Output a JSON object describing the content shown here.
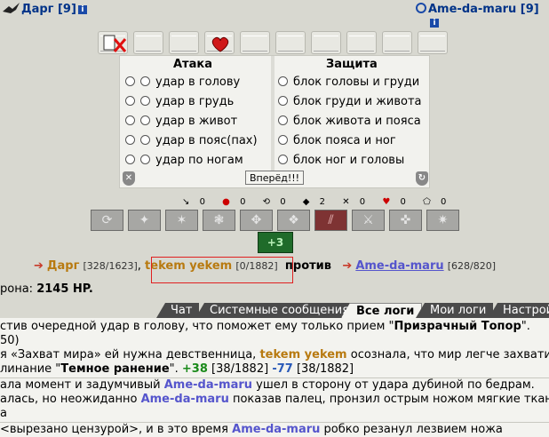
{
  "header": {
    "left_name": "Дарг [9]",
    "right_name": "Ame-da-maru [9]",
    "info_icon": "i"
  },
  "panel": {
    "attack_title": "Атака",
    "defense_title": "Защита",
    "attack_options": [
      "удар в голову",
      "удар в грудь",
      "удар в живот",
      "удар в пояс(пах)",
      "удар по ногам"
    ],
    "defense_options": [
      "блок головы и груди",
      "блок груди и живота",
      "блок живота и пояса",
      "блок пояса и ног",
      "блок ног и головы"
    ],
    "forward_label": "Вперёд!!!"
  },
  "counters": [
    "0",
    "0",
    "0",
    "2",
    "0",
    "0",
    "0"
  ],
  "special_label": "+3",
  "versus": {
    "p1_name": "Дарг",
    "p1_hp": "[328/1623]",
    "p2_name": "tekem yekem",
    "p2_hp": "[0/1882]",
    "vs_word": "против",
    "p3_name": "Ame-da-maru",
    "p3_hp": "[628/820]"
  },
  "damage": {
    "label": "рона:",
    "value": "2145 HP."
  },
  "tabs": [
    "Чат",
    "Системные сообщения",
    "Все логи",
    "Мои логи",
    "Настройки"
  ],
  "active_tab": "Все логи",
  "log": {
    "l1a": "стив очередной удар в голову, что поможет ему только прием \"",
    "l1b": "Призрачный Топор",
    "l1c": "\".",
    "l2": "50)",
    "l3a": "я «Захват мира» ей нужна девственница, ",
    "l3b": "tekem yekem",
    "l3c": " осознала, что мир легче захватить",
    "l4a": "линание \"",
    "l4b": "Темное ранение",
    "l4c": "\". ",
    "l4d": "+38",
    "l4e": " [38/1882] ",
    "l4f": "-77",
    "l4g": " [38/1882]",
    "l5a": "ала момент и задумчивый ",
    "l5b": "Ame-da-maru",
    "l5c": " ушел в сторону от удара дубиной по бедрам.",
    "l6a": "алась, но неожиданно ",
    "l6b": "Ame-da-maru",
    "l6c": " показав палец, пронзил острым ножом мягкие ткани",
    "l7": "а",
    "l8a": " <вырезано цензурой>, и в это время ",
    "l8b": "Ame-da-maru",
    "l8c": " робко резанул лезвием ножа"
  }
}
